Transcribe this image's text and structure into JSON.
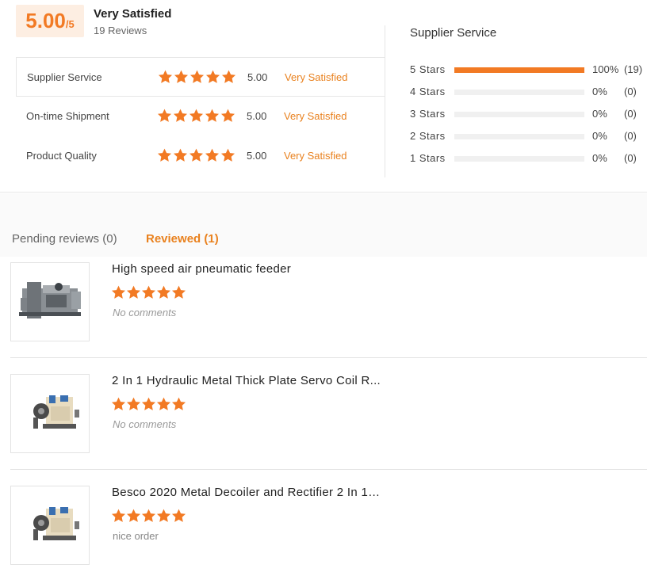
{
  "summary": {
    "score": "5.00",
    "score_denominator": "/5",
    "score_title": "Very Satisfied",
    "review_count": "19 Reviews"
  },
  "ratings": [
    {
      "label": "Supplier Service",
      "value": "5.00",
      "satisfaction": "Very Satisfied",
      "stars": 5
    },
    {
      "label": "On-time Shipment",
      "value": "5.00",
      "satisfaction": "Very Satisfied",
      "stars": 5
    },
    {
      "label": "Product Quality",
      "value": "5.00",
      "satisfaction": "Very Satisfied",
      "stars": 5
    }
  ],
  "distribution": {
    "title": "Supplier Service",
    "rows": [
      {
        "label": "5  Stars",
        "percent": "100%",
        "count": "(19)",
        "fraction": 1.0
      },
      {
        "label": "4  Stars",
        "percent": "0%",
        "count": "(0)",
        "fraction": 0
      },
      {
        "label": "3  Stars",
        "percent": "0%",
        "count": "(0)",
        "fraction": 0
      },
      {
        "label": "2  Stars",
        "percent": "0%",
        "count": "(0)",
        "fraction": 0
      },
      {
        "label": "1  Stars",
        "percent": "0%",
        "count": "(0)",
        "fraction": 0
      }
    ]
  },
  "tabs": {
    "pending": "Pending reviews (0)",
    "reviewed": "Reviewed (1)"
  },
  "reviews": [
    {
      "title": "High speed air pneumatic feeder",
      "stars": 5,
      "comment": "No comments",
      "comment_italic": true,
      "image": "pneumatic-feeder-image"
    },
    {
      "title": "2 In 1 Hydraulic Metal Thick Plate Servo Coil R...",
      "stars": 5,
      "comment": "No comments",
      "comment_italic": true,
      "image": "decoiler-straightener-image"
    },
    {
      "title": "Besco 2020 Metal Decoiler and Rectifier 2 In 1 ...",
      "stars": 5,
      "comment": "nice order",
      "comment_italic": false,
      "image": "decoiler-straightener-image"
    }
  ],
  "colors": {
    "accent": "#f27a24",
    "satisfied_text": "#e9811e",
    "score_bg": "#fdeee2"
  }
}
